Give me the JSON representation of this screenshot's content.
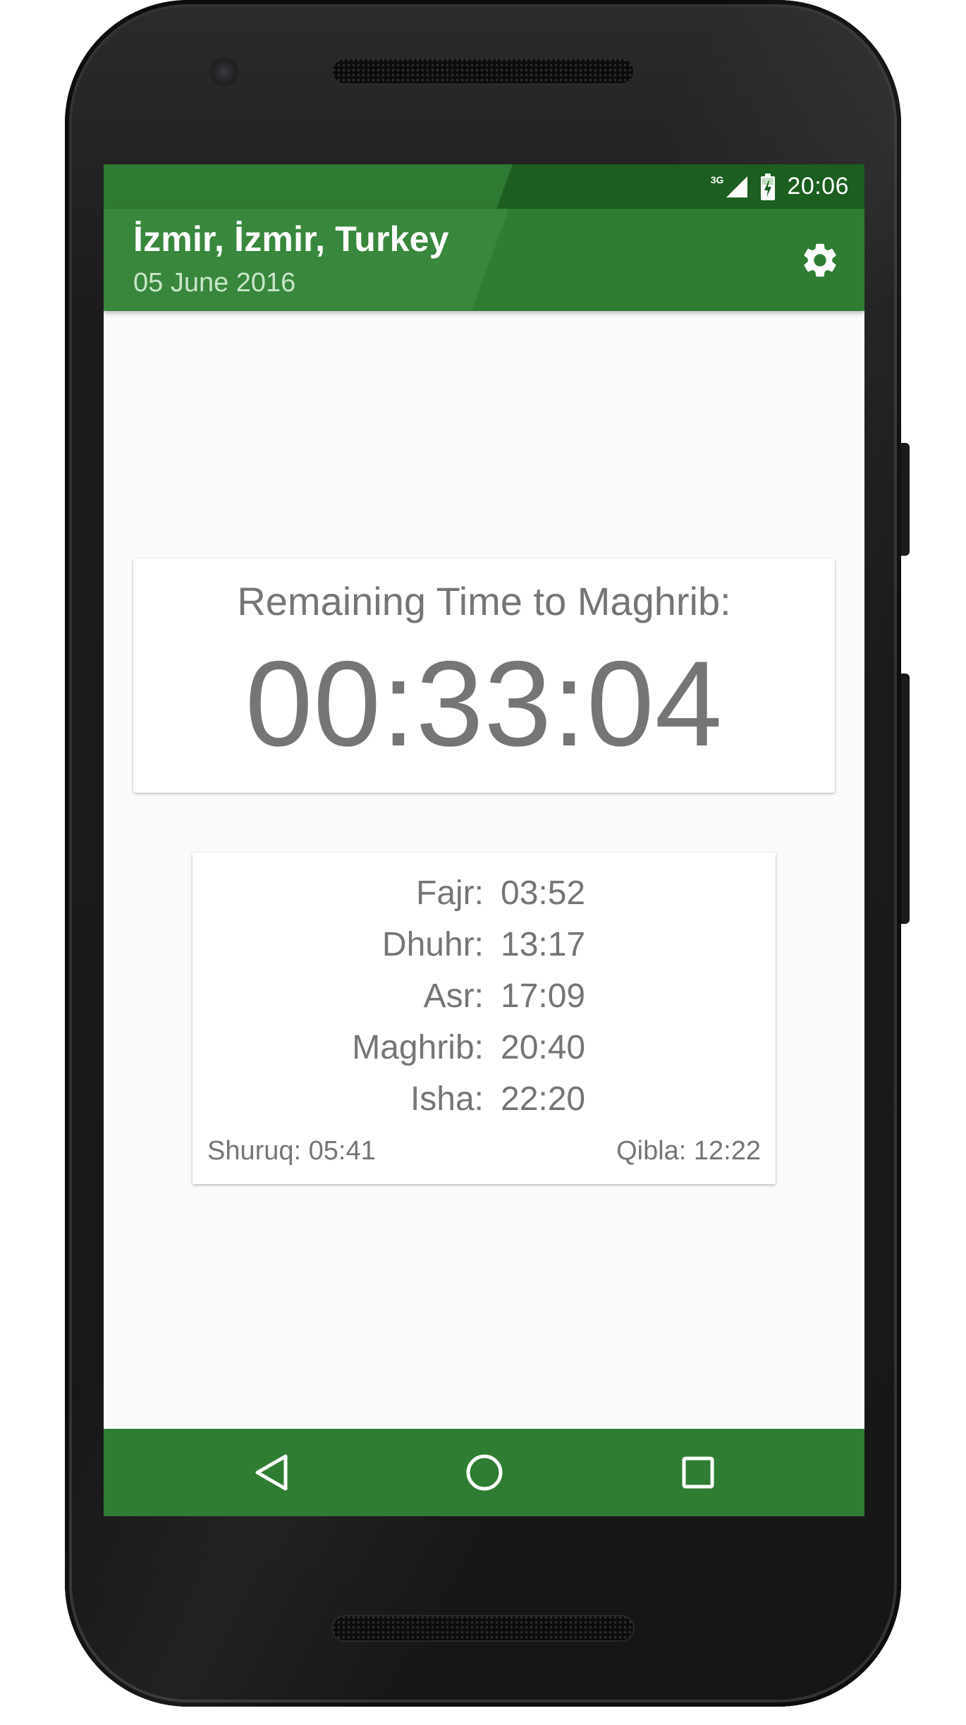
{
  "status_bar": {
    "network_type": "3G",
    "time": "20:06",
    "icons": [
      "signal-icon",
      "battery-charging-icon"
    ]
  },
  "app_bar": {
    "title": "İzmir, İzmir, Turkey",
    "subtitle": "05 June 2016",
    "settings_icon": "gear-icon"
  },
  "countdown": {
    "label": "Remaining Time to Maghrib:",
    "value": "00:33:04"
  },
  "prayer_times": [
    {
      "name": "Fajr:",
      "time": "03:52"
    },
    {
      "name": "Dhuhr:",
      "time": "13:17"
    },
    {
      "name": "Asr:",
      "time": "17:09"
    },
    {
      "name": "Maghrib:",
      "time": "20:40"
    },
    {
      "name": "Isha:",
      "time": "22:20"
    }
  ],
  "footer": {
    "shuruq": "Shuruq: 05:41",
    "qibla": "Qibla: 12:22"
  },
  "nav_bar": {
    "icons": [
      "back-icon",
      "home-icon",
      "recents-icon"
    ]
  },
  "colors": {
    "primary": "#2e7d32",
    "primary_dark": "#1c5e20",
    "subtitle": "#c8e6c9",
    "text_gray": "#757575",
    "background": "#fafafa"
  }
}
